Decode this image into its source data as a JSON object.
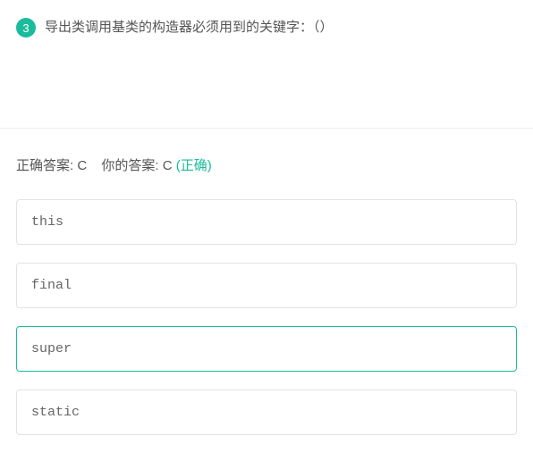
{
  "question": {
    "number": "3",
    "text": "导出类调用基类的构造器必须用到的关键字：（）"
  },
  "answer": {
    "correct_label": "正确答案: ",
    "correct_letter": "C",
    "your_label": "你的答案: ",
    "your_letter": "C",
    "status": "(正确)"
  },
  "options": [
    {
      "text": "this",
      "selected": false
    },
    {
      "text": "final",
      "selected": false
    },
    {
      "text": "super",
      "selected": true
    },
    {
      "text": "static",
      "selected": false
    }
  ]
}
